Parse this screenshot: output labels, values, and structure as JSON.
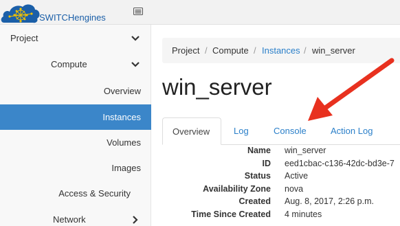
{
  "brand": {
    "name": "SWITCHengines",
    "logo_color": "#1b5fa8"
  },
  "sidebar": {
    "items": [
      {
        "label": "Project",
        "icon": "chevron-down-icon"
      },
      {
        "label": "Compute",
        "icon": "chevron-down-icon"
      },
      {
        "label": "Overview"
      },
      {
        "label": "Instances",
        "active": true
      },
      {
        "label": "Volumes"
      },
      {
        "label": "Images"
      },
      {
        "label": "Access & Security"
      },
      {
        "label": "Network",
        "icon": "chevron-right-icon"
      }
    ],
    "active_color": "#3b86c9"
  },
  "breadcrumb": {
    "items": [
      "Project",
      "Compute",
      "Instances",
      "win_server"
    ],
    "separator": "/"
  },
  "page": {
    "title": "win_server"
  },
  "tabs": [
    {
      "label": "Overview",
      "active": true
    },
    {
      "label": "Log"
    },
    {
      "label": "Console"
    },
    {
      "label": "Action Log"
    }
  ],
  "details": [
    {
      "label": "Name",
      "value": "win_server"
    },
    {
      "label": "ID",
      "value": "eed1cbac-c136-42dc-bd3e-7"
    },
    {
      "label": "Status",
      "value": "Active"
    },
    {
      "label": "Availability Zone",
      "value": "nova"
    },
    {
      "label": "Created",
      "value": "Aug. 8, 2017, 2:26 p.m."
    },
    {
      "label": "Time Since Created",
      "value": "4 minutes"
    }
  ],
  "annotation": {
    "color": "#e8311f",
    "points_to": "Console"
  }
}
